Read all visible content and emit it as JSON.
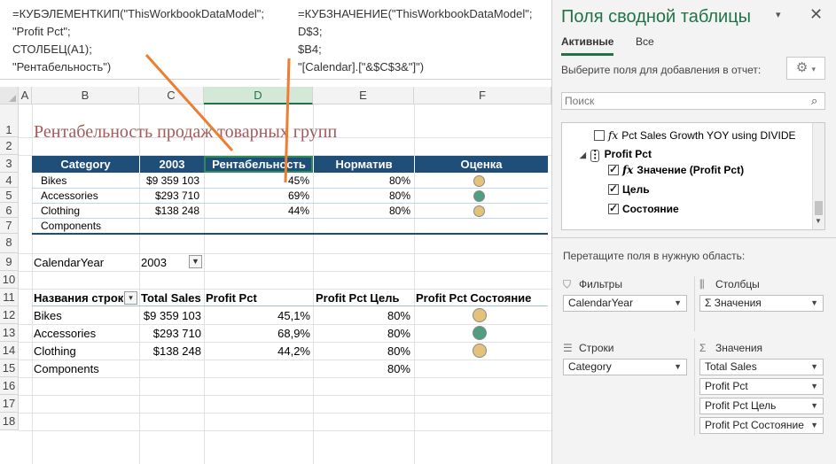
{
  "formula1": {
    "lines": [
      "=КУБЭЛЕМЕНТКИП(\"ThisWorkbookDataModel\";",
      "\"Profit Pct\";",
      "СТОЛБЕЦ(A1);",
      "\"Рентабельность\")"
    ]
  },
  "formula2": {
    "lines": [
      "=КУБЗНАЧЕНИЕ(\"ThisWorkbookDataModel\";",
      "D$3;",
      "$B4;",
      "\"[Calendar].[\"&$C$3&\"]\")"
    ]
  },
  "sheet": {
    "columns": [
      "A",
      "B",
      "C",
      "D",
      "E",
      "F"
    ],
    "rows": [
      "1",
      "2",
      "3",
      "4",
      "5",
      "6",
      "7",
      "8",
      "9",
      "10",
      "11",
      "12",
      "13",
      "14",
      "15",
      "16",
      "17",
      "18"
    ],
    "title": "Рентабельность продаж товарных групп",
    "cube_table": {
      "headers": [
        "Category",
        "2003",
        "Рентабельность",
        "Норматив",
        "Оценка"
      ],
      "rows": [
        {
          "category": "Bikes",
          "sales": "$9 359 103",
          "pct": "45%",
          "norm": "80%",
          "status": "#e5c27a"
        },
        {
          "category": "Accessories",
          "sales": "$293 710",
          "pct": "69%",
          "norm": "80%",
          "status": "#4f9e7f"
        },
        {
          "category": "Clothing",
          "sales": "$138 248",
          "pct": "44%",
          "norm": "80%",
          "status": "#e5c27a"
        },
        {
          "category": "Components",
          "sales": "",
          "pct": "",
          "norm": "",
          "status": ""
        }
      ]
    },
    "filter": {
      "label": "CalendarYear",
      "value": "2003",
      "icon": "filter-icon"
    },
    "pivot": {
      "headers": [
        "Названия строк",
        "Total Sales",
        "Profit Pct",
        "Profit Pct Цель",
        "Profit Pct Состояние"
      ],
      "rows": [
        {
          "category": "Bikes",
          "sales": "$9 359 103",
          "pct": "45,1%",
          "goal": "80%",
          "status": "#e5c27a"
        },
        {
          "category": "Accessories",
          "sales": "$293 710",
          "pct": "68,9%",
          "goal": "80%",
          "status": "#4f9e7f"
        },
        {
          "category": "Clothing",
          "sales": "$138 248",
          "pct": "44,2%",
          "goal": "80%",
          "status": "#e5c27a"
        },
        {
          "category": "Components",
          "sales": "",
          "pct": "",
          "goal": "80%",
          "status": ""
        }
      ]
    }
  },
  "pane": {
    "title": "Поля сводной таблицы",
    "tabs": {
      "active": "Активные",
      "all": "Все"
    },
    "choose_fields": "Выберите поля для добавления в отчет:",
    "search_placeholder": "Поиск",
    "fields": {
      "growth": "Pct Sales Growth YOY using DIVIDE",
      "kpi_group": "Profit Pct",
      "value": "Значение (Profit Pct)",
      "goal": "Цель",
      "status": "Состояние"
    },
    "drag_text": "Перетащите поля в нужную область:",
    "areas": {
      "filters": {
        "title": "Фильтры",
        "items": [
          "CalendarYear"
        ]
      },
      "columns": {
        "title": "Столбцы",
        "items": [
          "Σ Значения"
        ]
      },
      "rows": {
        "title": "Строки",
        "items": [
          "Category"
        ]
      },
      "values": {
        "title": "Значения",
        "items": [
          "Total Sales",
          "Profit Pct",
          "Profit Pct Цель",
          "Profit Pct Состояние"
        ]
      }
    }
  },
  "colors": {
    "accent": "#217346",
    "header_blue": "#1f4e79",
    "annotation": "#ed7d31"
  }
}
